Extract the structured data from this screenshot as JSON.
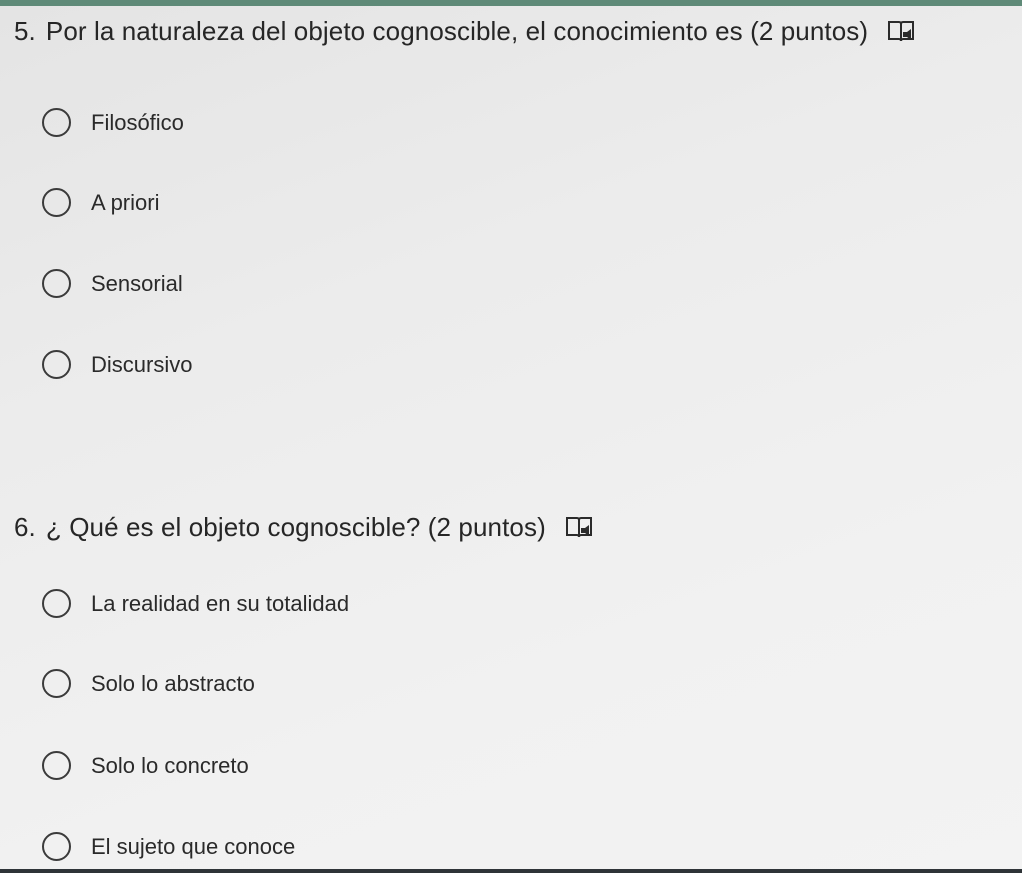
{
  "questions": [
    {
      "number": "5.",
      "text": "Por la naturaleza del objeto cognoscible, el conocimiento es (2 puntos)",
      "reader_icon": "immersive-reader-icon",
      "options": [
        "Filosófico",
        "A priori",
        "Sensorial",
        "Discursivo"
      ]
    },
    {
      "number": "6.",
      "text": "¿ Qué es el objeto cognoscible? (2 puntos)",
      "reader_icon": "immersive-reader-icon",
      "options": [
        "La realidad en su totalidad",
        "Solo lo abstracto",
        "Solo lo concreto",
        "El sujeto que conoce"
      ]
    }
  ]
}
